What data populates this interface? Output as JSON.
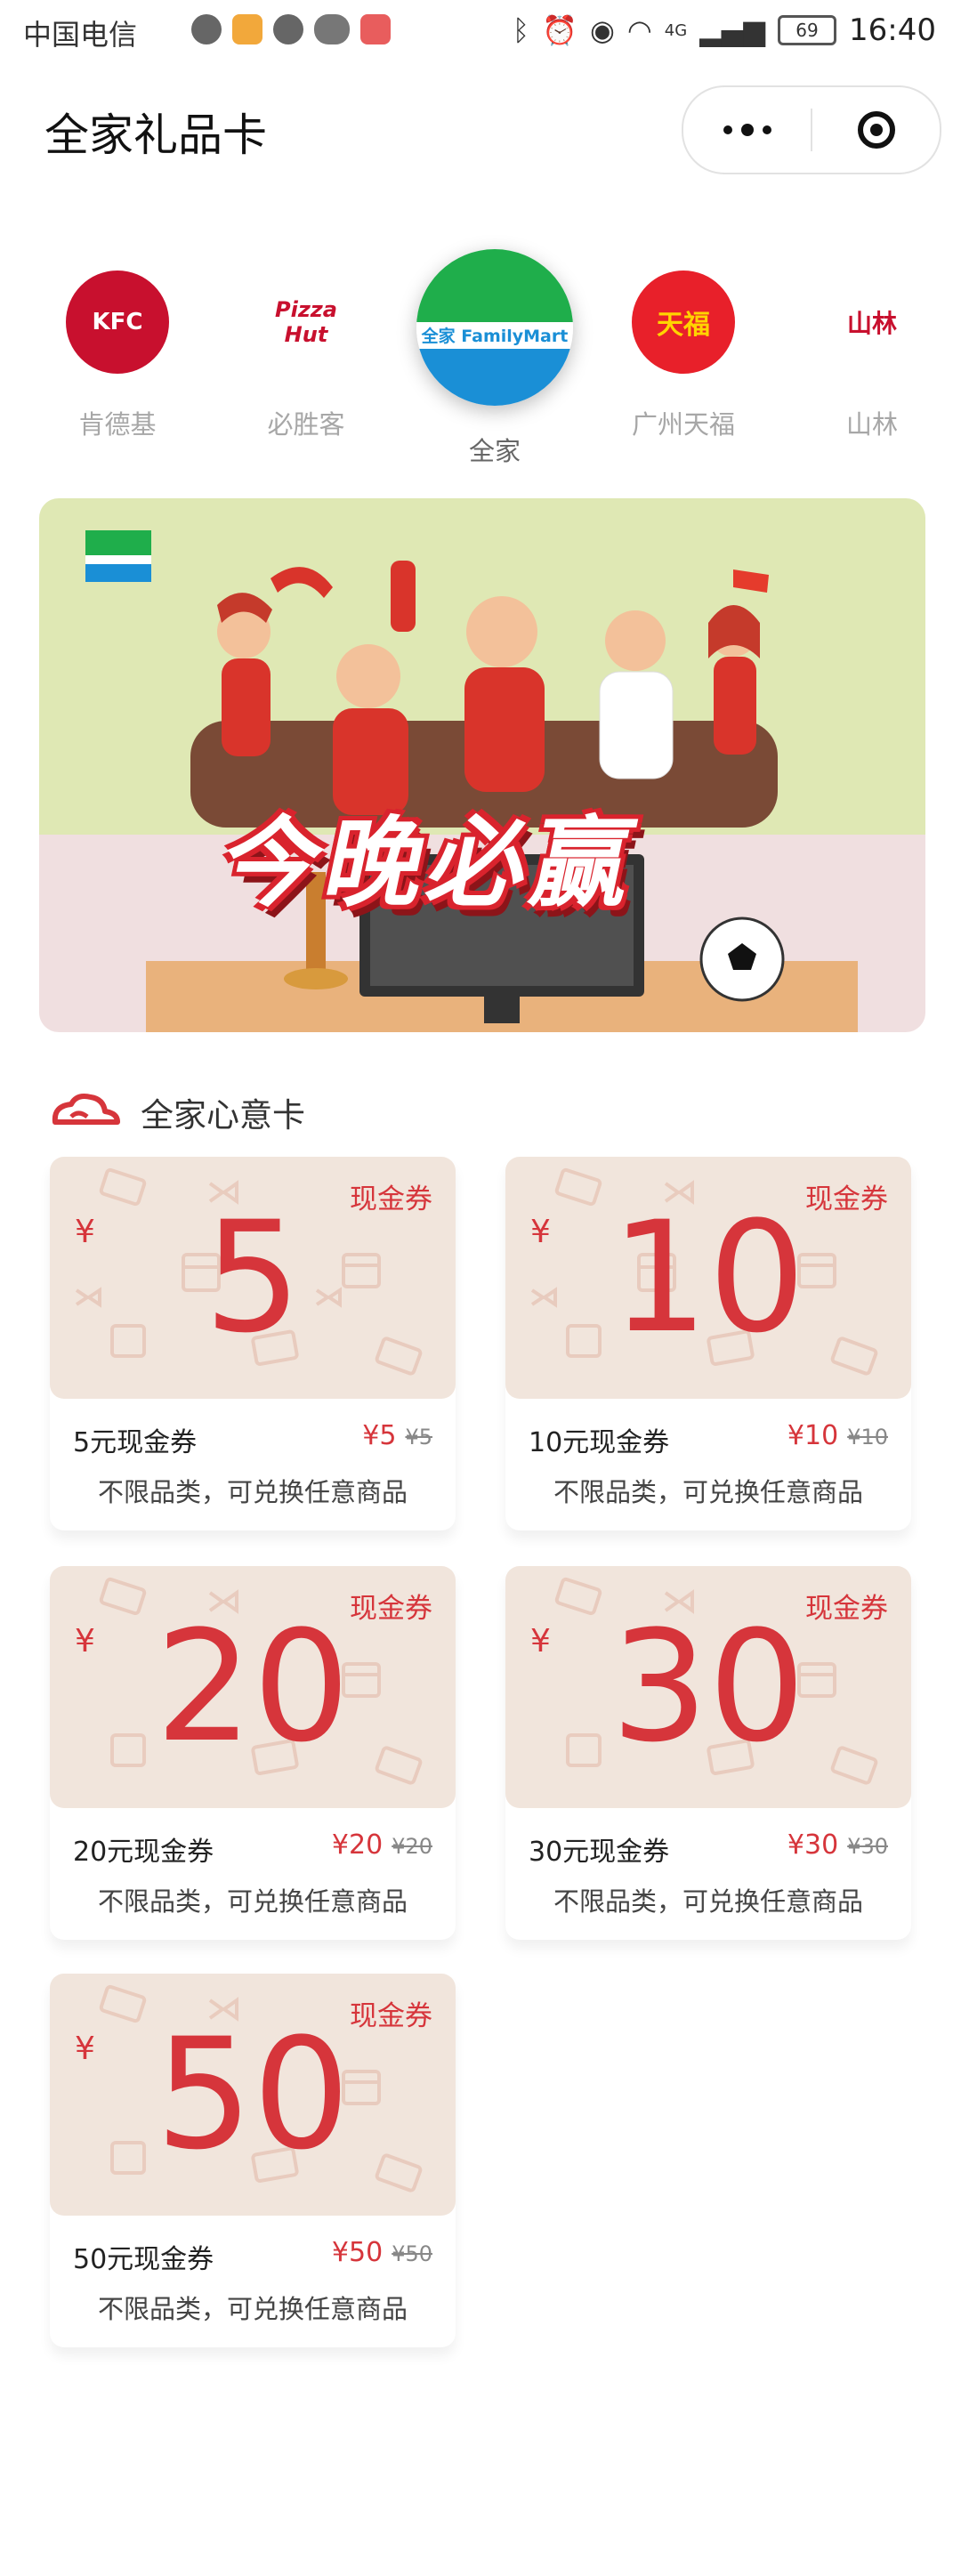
{
  "status_bar": {
    "carrier": "中国电信",
    "network": "4G",
    "battery": "69",
    "time": "16:40"
  },
  "header": {
    "title": "全家礼品卡"
  },
  "brands": [
    {
      "name": "肯德基",
      "logo_text": "KFC"
    },
    {
      "name": "必胜客",
      "logo_text": "Pizza Hut"
    },
    {
      "name": "全家",
      "logo_text": "全家 FamilyMart",
      "active": true
    },
    {
      "name": "广州天福",
      "logo_text": "天福"
    },
    {
      "name": "山林",
      "logo_text": "山林"
    }
  ],
  "banner": {
    "logo_text": "全家 FamilyMart",
    "slogan": "今晚必赢"
  },
  "section": {
    "title": "全家心意卡"
  },
  "cards": [
    {
      "amount": "5",
      "tag": "现金券",
      "yen": "¥",
      "name": "5元现金券",
      "price": "¥5",
      "original": "¥5",
      "desc": "不限品类，可兑换任意商品"
    },
    {
      "amount": "10",
      "tag": "现金券",
      "yen": "¥",
      "name": "10元现金券",
      "price": "¥10",
      "original": "¥10",
      "desc": "不限品类，可兑换任意商品"
    },
    {
      "amount": "20",
      "tag": "现金券",
      "yen": "¥",
      "name": "20元现金券",
      "price": "¥20",
      "original": "¥20",
      "desc": "不限品类，可兑换任意商品"
    },
    {
      "amount": "30",
      "tag": "现金券",
      "yen": "¥",
      "name": "30元现金券",
      "price": "¥30",
      "original": "¥30",
      "desc": "不限品类，可兑换任意商品"
    },
    {
      "amount": "50",
      "tag": "现金券",
      "yen": "¥",
      "name": "50元现金券",
      "price": "¥50",
      "original": "¥50",
      "desc": "不限品类，可兑换任意商品"
    }
  ],
  "colors": {
    "accent": "#d6353b",
    "card_face": "#f1e5dc",
    "familymart_green": "#1fae4b",
    "familymart_blue": "#1a8fd6"
  }
}
